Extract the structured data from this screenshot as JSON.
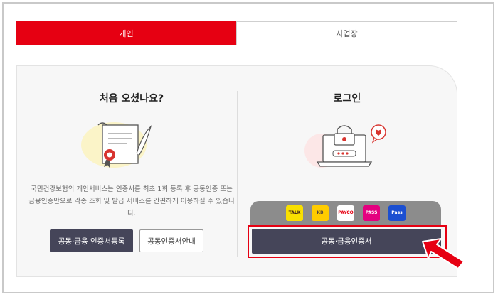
{
  "tabs": [
    {
      "label": "개인",
      "active": true
    },
    {
      "label": "사업장",
      "active": false
    }
  ],
  "left": {
    "title": "처음 오셨나요?",
    "description": "국민건강보험의 개인서비스는 인증서를 최초 1회 등록 후 공동인증 또는 금융인증만으로 각종 조회 및 발급 서비스를 간편하게 이용하실 수 있습니다.",
    "register_button": "공동·금융 인증서등록",
    "guide_button": "공동인증서안내"
  },
  "right": {
    "title": "로그인",
    "cert_providers": [
      {
        "name": "TALK",
        "icon": "kakao-talk-icon",
        "bg": "#f9e000",
        "fg": "#3a1d1d"
      },
      {
        "name": "KB",
        "icon": "kb-icon",
        "bg": "#ffcc00",
        "fg": "#5b4a3a"
      },
      {
        "name": "PAYCO",
        "icon": "payco-icon",
        "bg": "#ffffff",
        "fg": "#e60012"
      },
      {
        "name": "PASS",
        "icon": "pass-icon",
        "bg": "#e4007f",
        "fg": "#ffffff"
      },
      {
        "name": "Pass",
        "icon": "samsung-pass-icon",
        "bg": "#1b4fd1",
        "fg": "#ffffff"
      }
    ],
    "login_button": "공동·금융인증서"
  },
  "colors": {
    "accent": "#e60012",
    "button_dark": "#454559",
    "panel_bg": "#f7f7f7"
  }
}
